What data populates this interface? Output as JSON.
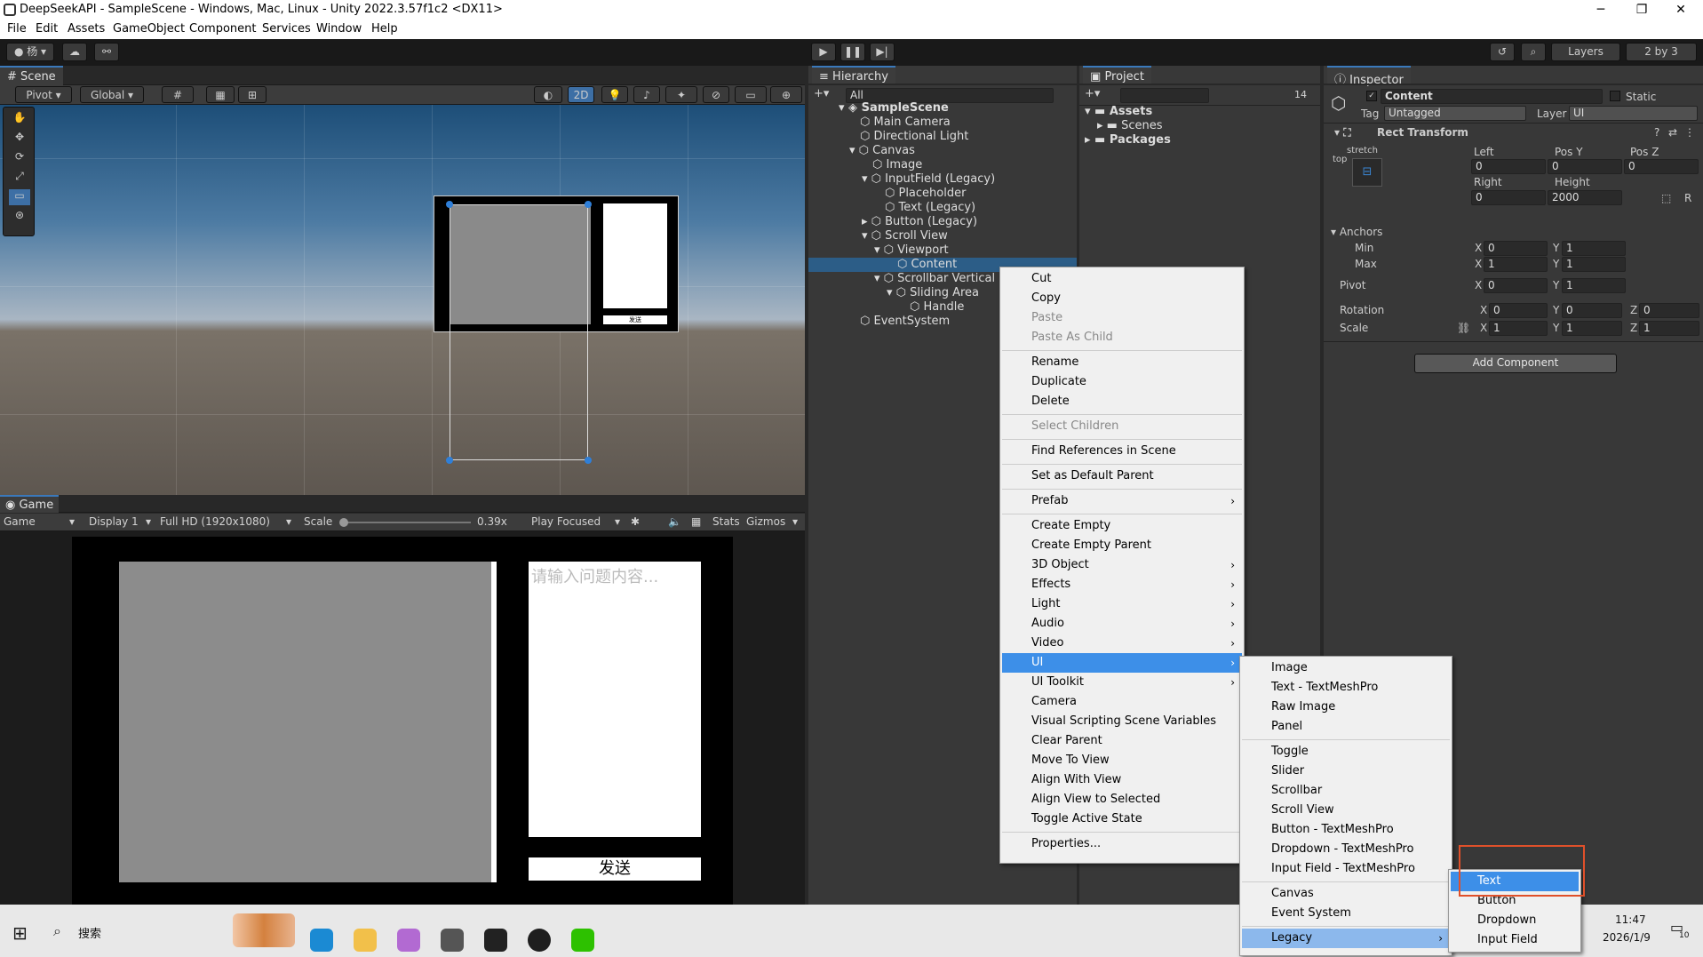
{
  "window": {
    "title": "DeepSeekAPI - SampleScene - Windows, Mac, Linux - Unity 2022.3.57f1c2 <DX11>",
    "minimize": "─",
    "maximize": "❐",
    "close": "✕"
  },
  "menubar": [
    "File",
    "Edit",
    "Assets",
    "GameObject",
    "Component",
    "Services",
    "Window",
    "Help"
  ],
  "toolbar": {
    "account": "● 杨 ▾",
    "layers": "Layers",
    "layout": "2 by 3"
  },
  "scene": {
    "tab": "Scene",
    "pivot": "Pivot",
    "global": "Global",
    "mode2d": "2D",
    "send_small": "发送"
  },
  "game": {
    "tab": "Game",
    "view": "Game",
    "display": "Display 1",
    "resolution": "Full HD (1920x1080)",
    "scale_label": "Scale",
    "scale_value": "0.39x",
    "play_mode": "Play Focused",
    "stats": "Stats",
    "gizmos": "Gizmos",
    "input_placeholder": "请输入问题内容...",
    "send_button": "发送"
  },
  "hierarchy": {
    "tab": "Hierarchy",
    "search_placeholder": "All",
    "items": [
      "SampleScene",
      "Main Camera",
      "Directional Light",
      "Canvas",
      "Image",
      "InputField (Legacy)",
      "Placeholder",
      "Text (Legacy)",
      "Button (Legacy)",
      "Scroll View",
      "Viewport",
      "Content",
      "Scrollbar Vertical",
      "Sliding Area",
      "Handle",
      "EventSystem"
    ],
    "selected": "Content"
  },
  "project": {
    "tab": "Project",
    "count": "14",
    "items": [
      "Assets",
      "Scenes",
      "Packages"
    ]
  },
  "inspector": {
    "tab": "Inspector",
    "object_name": "Content",
    "static_label": "Static",
    "tag_label": "Tag",
    "tag_value": "Untagged",
    "layer_label": "Layer",
    "layer_value": "UI",
    "component": "Rect Transform",
    "anchor_preset": "stretch",
    "anchor_side": "top",
    "left_label": "Left",
    "left": "0",
    "posy_label": "Pos Y",
    "posy": "0",
    "posz_label": "Pos Z",
    "posz": "0",
    "right_label": "Right",
    "right": "0",
    "height_label": "Height",
    "height": "2000",
    "anchors_label": "Anchors",
    "min_label": "Min",
    "min_x": "0",
    "min_y": "1",
    "max_label": "Max",
    "max_x": "1",
    "max_y": "1",
    "pivot_label": "Pivot",
    "pivot_x": "0",
    "pivot_y": "1",
    "rotation_label": "Rotation",
    "rot_x": "0",
    "rot_y": "0",
    "rot_z": "0",
    "scale_label": "Scale",
    "scale_x": "1",
    "scale_y": "1",
    "scale_z": "1",
    "add_component": "Add Component",
    "x": "X",
    "y": "Y",
    "z": "Z",
    "r": "R"
  },
  "context_menu": {
    "items": [
      "Cut",
      "Copy",
      "Paste",
      "Paste As Child",
      "Rename",
      "Duplicate",
      "Delete",
      "Select Children",
      "Find References in Scene",
      "Set as Default Parent",
      "Prefab",
      "Create Empty",
      "Create Empty Parent",
      "3D Object",
      "Effects",
      "Light",
      "Audio",
      "Video",
      "UI",
      "UI Toolkit",
      "Camera",
      "Visual Scripting Scene Variables",
      "Clear Parent",
      "Move To View",
      "Align With View",
      "Align View to Selected",
      "Toggle Active State",
      "Properties..."
    ],
    "disabled": [
      "Paste",
      "Paste As Child",
      "Select Children"
    ],
    "selected": "UI"
  },
  "ui_submenu": {
    "items": [
      "Image",
      "Text - TextMeshPro",
      "Raw Image",
      "Panel",
      "Toggle",
      "Slider",
      "Scrollbar",
      "Scroll View",
      "Button - TextMeshPro",
      "Dropdown - TextMeshPro",
      "Input Field - TextMeshPro",
      "Canvas",
      "Event System",
      "Legacy"
    ],
    "selected": "Legacy"
  },
  "legacy_submenu": {
    "items": [
      "Text",
      "Button",
      "Dropdown",
      "Input Field"
    ],
    "selected": "Text",
    "highlight_color": "#e0502a"
  },
  "taskbar": {
    "search": "搜索",
    "time": "11:47",
    "date": "2026/1/9",
    "notifications": "10"
  },
  "colors": {
    "accent": "#3d8fe8",
    "selection": "#2c5d87"
  }
}
